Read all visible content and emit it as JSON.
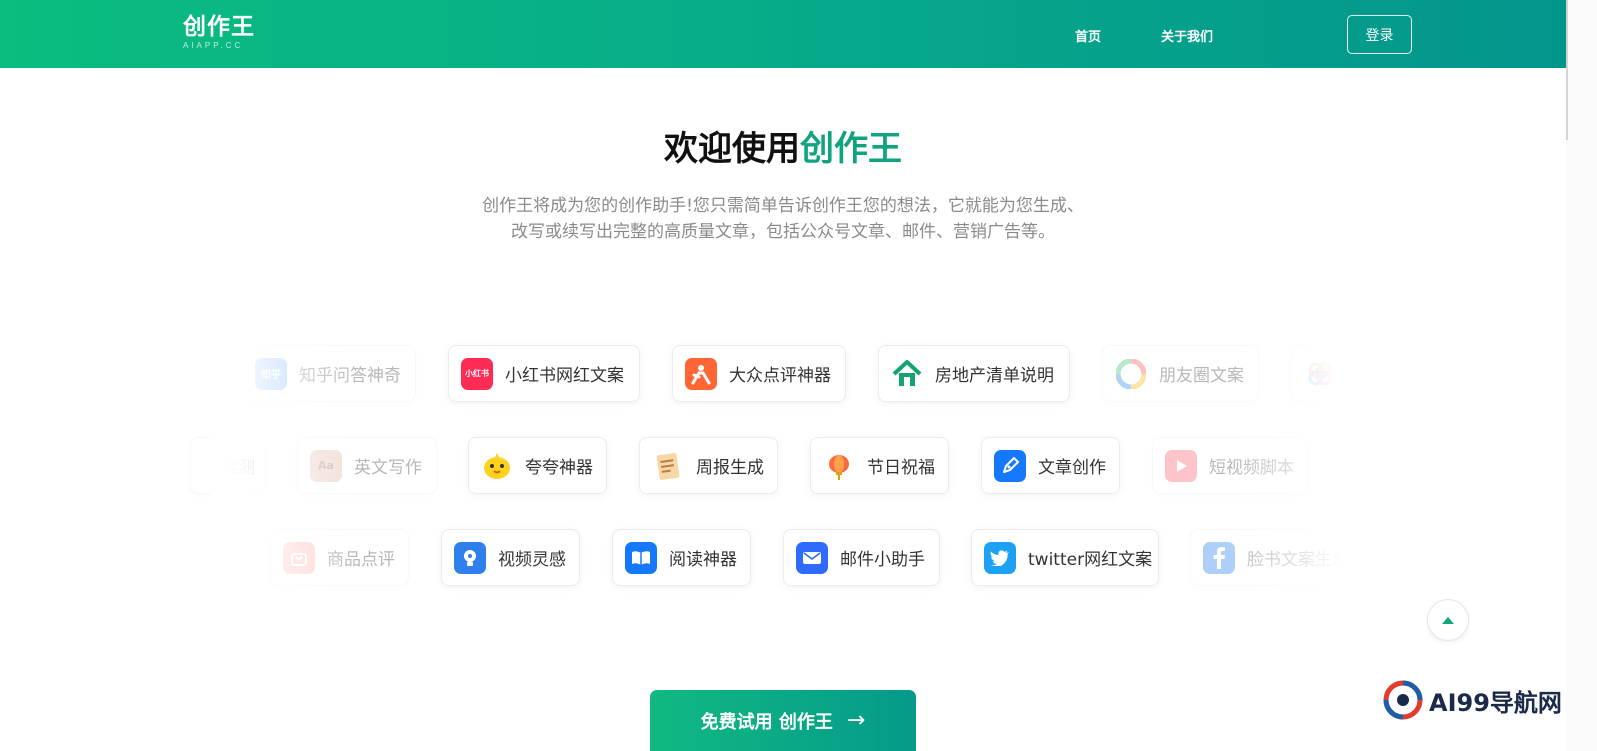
{
  "header": {
    "logo_text": "创作王",
    "logo_sub": "AIAPP.CC",
    "nav": [
      "首页",
      "关于我们"
    ],
    "login_label": "登录"
  },
  "hero": {
    "title_prefix": "欢迎使用",
    "title_brand": "创作王",
    "desc_line1": "创作王将成为您的创作助手!您只需简单告诉创作王您的想法，它就能为您生成、",
    "desc_line2": "改写或续写出完整的高质量文章，包括公众号文章、邮件、营销广告等。"
  },
  "rows": [
    [
      {
        "label": "知乎问答神奇",
        "icon": "zhihu-icon",
        "glyph": "知乎",
        "color": "#1e80ff",
        "faded": true
      },
      {
        "label": "小红书网红文案",
        "icon": "xiaohongshu-icon",
        "glyph": "小红书",
        "color": "#fe2c55",
        "faded": false
      },
      {
        "label": "大众点评神器",
        "icon": "dianping-icon",
        "glyph": "",
        "color": "#ff6633",
        "faded": false
      },
      {
        "label": "房地产清单说明",
        "icon": "house-icon",
        "glyph": "",
        "color": "#ffffff",
        "faded": false
      },
      {
        "label": "朋友圈文案",
        "icon": "moments-icon",
        "glyph": "",
        "color": "#ffffff",
        "faded": true
      },
      {
        "label": "",
        "icon": "flower-icon",
        "glyph": "",
        "color": "#ffffff",
        "faded": true
      }
    ],
    [
      {
        "label": "检测",
        "icon": "",
        "glyph": "",
        "color": "",
        "faded": true
      },
      {
        "label": "英文写作",
        "icon": "english-book-icon",
        "glyph": "Aa",
        "color": "#d9a48f",
        "faded": true
      },
      {
        "label": "夸夸神器",
        "icon": "chick-icon",
        "glyph": "",
        "color": "#ffffff",
        "faded": false
      },
      {
        "label": "周报生成",
        "icon": "notepad-icon",
        "glyph": "",
        "color": "#ffffff",
        "faded": false
      },
      {
        "label": "节日祝福",
        "icon": "lantern-icon",
        "glyph": "",
        "color": "#ffffff",
        "faded": false
      },
      {
        "label": "文章创作",
        "icon": "pen-icon",
        "glyph": "",
        "color": "#1677ff",
        "faded": false
      },
      {
        "label": "短视频脚本",
        "icon": "video-play-icon",
        "glyph": "",
        "color": "#ff5a6a",
        "faded": true
      }
    ],
    [
      {
        "label": "商品点评",
        "icon": "shopping-bag-icon",
        "glyph": "",
        "color": "#ff8a80",
        "faded": true
      },
      {
        "label": "视频灵感",
        "icon": "lightbulb-icon",
        "glyph": "",
        "color": "#2f80ed",
        "faded": false
      },
      {
        "label": "阅读神器",
        "icon": "open-book-icon",
        "glyph": "",
        "color": "#1677ff",
        "faded": false
      },
      {
        "label": "邮件小助手",
        "icon": "mail-icon",
        "glyph": "",
        "color": "#2f6bff",
        "faded": false
      },
      {
        "label": "twitter网红文案",
        "icon": "twitter-icon",
        "glyph": "",
        "color": "#1da1f2",
        "faded": false
      },
      {
        "label": "脸书文案生成",
        "icon": "facebook-icon",
        "glyph": "",
        "color": "#1877f2",
        "faded": true
      }
    ]
  ],
  "cta": {
    "label": "免费试用 创作王"
  },
  "watermark": {
    "text": "AI99导航网"
  },
  "colors": {
    "brand": "#10a37f",
    "header_start": "#0bbd7f",
    "header_end": "#03958c"
  }
}
